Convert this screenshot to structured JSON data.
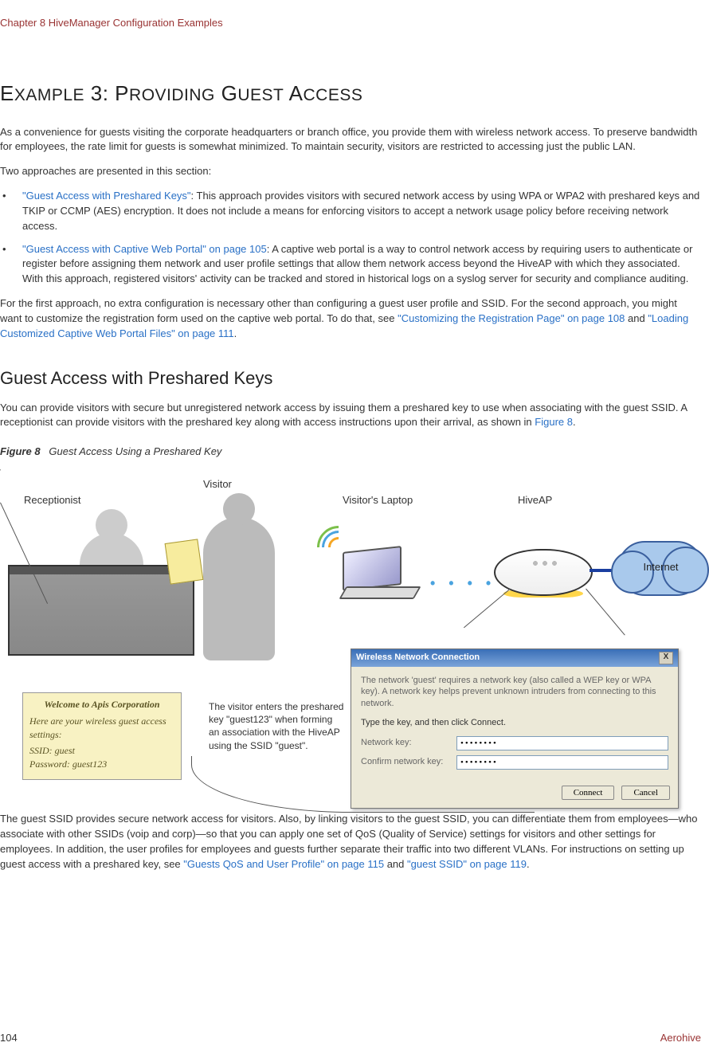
{
  "header": {
    "chapter": "Chapter 8 HiveManager Configuration Examples"
  },
  "title": "Example 3: Providing Guest Access",
  "intro": "As a convenience for guests visiting the corporate headquarters or branch office, you provide them with wireless network access. To preserve bandwidth for employees, the rate limit for guests is somewhat minimized. To maintain security, visitors are restricted to accessing just the public LAN.",
  "intro2": "Two approaches are presented in this section:",
  "bullets": [
    {
      "link": "\"Guest Access with Preshared Keys\"",
      "rest": ": This approach provides visitors with secured network access by using WPA or WPA2 with preshared keys and TKIP or CCMP (AES) encryption. It does not include a means for enforcing visitors to accept a network usage policy before receiving network access."
    },
    {
      "link": "\"Guest Access with Captive Web Portal\" on page 105",
      "rest": ": A captive web portal is a way to control network access by requiring users to authenticate or register before assigning them network and user profile settings that allow them network access beyond the HiveAP with which they associated. With this approach, registered visitors' activity can be tracked and stored in historical logs on a syslog server for security and compliance auditing."
    }
  ],
  "para_after_bullets_1": "For the first approach, no extra configuration is necessary other than configuring a guest user profile and SSID. For the second approach, you might want to customize the registration form used on the captive web portal. To do that, see ",
  "para_after_bullets_link1": "\"Customizing the Registration Page\" on page 108",
  "para_after_bullets_mid": " and ",
  "para_after_bullets_link2": "\"Loading Customized Captive Web Portal Files\" on page 111",
  "para_after_bullets_end": ".",
  "h2": "Guest Access with Preshared Keys",
  "h2_para_1": "You can provide visitors with secure but unregistered network access by issuing them a preshared key to use when associating with the guest SSID. A receptionist can provide visitors with the preshared key along with access instructions upon their arrival, as shown in ",
  "h2_para_link": "Figure 8",
  "h2_para_end": ".",
  "figure_label_num": "Figure 8",
  "figure_label_text": "Guest Access Using a Preshared Key",
  "figure": {
    "receptionist": "Receptionist",
    "visitor": "Visitor",
    "visitors_laptop": "Visitor's Laptop",
    "hiveap": "HiveAP",
    "internet": "Internet",
    "note_title": "Welcome to Apis Corporation",
    "note_line1": "Here are your wireless guest access settings:",
    "note_line2": "SSID: guest",
    "note_line3": "Password: guest123",
    "caption": "The visitor enters the preshared key \"guest123\" when forming an association with the HiveAP using the SSID \"guest\".",
    "dialog": {
      "title": "Wireless Network Connection",
      "help": "The network 'guest' requires a network key (also called a WEP key or WPA key). A network key helps prevent unknown intruders from connecting to this network.",
      "type_line": "Type the key, and then click Connect.",
      "netkey_label": "Network key:",
      "confkey_label": "Confirm network key:",
      "netkey_value": "••••••••",
      "confkey_value": "••••••••",
      "btn_connect": "Connect",
      "btn_cancel": "Cancel",
      "close_x": "X"
    }
  },
  "closing_1": "The guest SSID provides secure network access for visitors. Also, by linking visitors to the guest SSID, you can differentiate them from employees—who associate with other SSIDs (voip and corp)—so that you can apply one set of QoS (Quality of Service) settings for visitors and other settings for employees. In addition, the user profiles for employees and guests further separate their traffic into two different VLANs. For instructions on setting up guest access with a preshared key, see ",
  "closing_link1": "\"Guests QoS and User Profile\" on page 115",
  "closing_mid": " and ",
  "closing_link2": "\"guest SSID\" on page 119",
  "closing_end": ".",
  "footer": {
    "page": "104",
    "brand": "Aerohive"
  }
}
